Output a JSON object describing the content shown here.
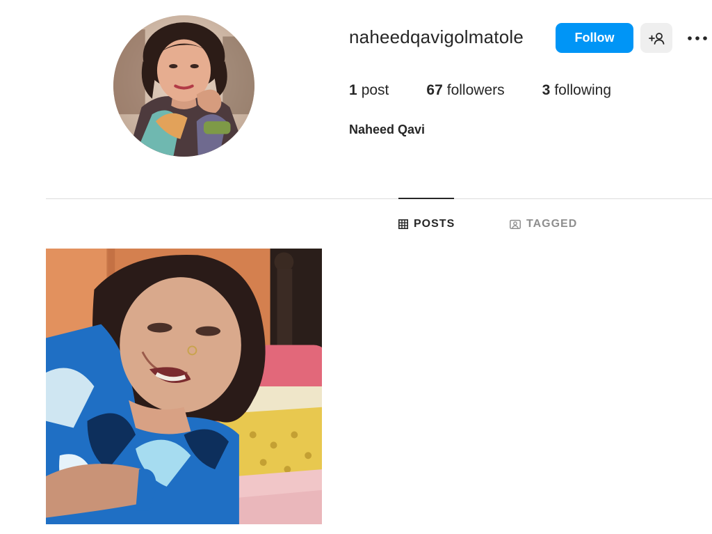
{
  "profile": {
    "username": "naheedqavigolmatole",
    "full_name": "Naheed Qavi",
    "avatar_icon": "profile-photo"
  },
  "actions": {
    "follow_label": "Follow",
    "suggest_icon": "person-add-icon",
    "more_icon": "more-options-icon"
  },
  "stats": {
    "posts": {
      "count": "1",
      "label": "post"
    },
    "followers": {
      "count": "67",
      "label": "followers"
    },
    "following": {
      "count": "3",
      "label": "following"
    }
  },
  "tabs": [
    {
      "label": "POSTS",
      "icon": "grid-icon",
      "active": true
    },
    {
      "label": "TAGGED",
      "icon": "tagged-icon",
      "active": false
    }
  ],
  "posts": [
    {
      "icon": "post-photo"
    }
  ],
  "colors": {
    "primary_button": "#0095f6",
    "secondary_button": "#efefef",
    "text": "#262626",
    "muted_text": "#8e8e8e",
    "divider": "#dbdbdb"
  }
}
